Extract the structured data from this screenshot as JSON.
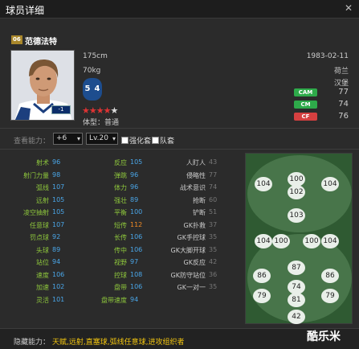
{
  "window": {
    "title": "球员详细",
    "close_glyph": "✕"
  },
  "player": {
    "position_badge": "06",
    "name": "范德法特",
    "height": "175cm",
    "weight": "70kg",
    "left_foot": "5",
    "right_foot": "4",
    "star_rating": 4,
    "star_max": 5,
    "body_type": "体型：普通",
    "birth_date": "1983-02-11",
    "nation": "荷兰",
    "club": "汉堡",
    "foot_badge": "-1"
  },
  "roles": [
    {
      "code": "CAM",
      "value": "77",
      "color": "#2eaa4a"
    },
    {
      "code": "CM",
      "value": "74",
      "color": "#2eaa4a"
    },
    {
      "code": "CF",
      "value": "76",
      "color": "#d64040"
    }
  ],
  "controls": {
    "view_label": "查看能力：",
    "plus_select": "+6",
    "level_select": "Lv.20",
    "checkbox_strong": "强化套",
    "checkbox_team": "队套",
    "arrow": "▾"
  },
  "stats_col1": [
    {
      "label": "射术",
      "value": "96"
    },
    {
      "label": "射门力量",
      "value": "98"
    },
    {
      "label": "弧线",
      "value": "107"
    },
    {
      "label": "远射",
      "value": "105"
    },
    {
      "label": "凌空抽射",
      "value": "105"
    },
    {
      "label": "任意球",
      "value": "107"
    },
    {
      "label": "罚点球",
      "value": "92"
    },
    {
      "label": "头球",
      "value": "89"
    },
    {
      "label": "站位",
      "value": "94"
    },
    {
      "label": "速度",
      "value": "106"
    },
    {
      "label": "加速",
      "value": "102"
    },
    {
      "label": "灵活",
      "value": "101"
    }
  ],
  "stats_col2": [
    {
      "label": "反应",
      "value": "105"
    },
    {
      "label": "弹跳",
      "value": "96"
    },
    {
      "label": "体力",
      "value": "96"
    },
    {
      "label": "强壮",
      "value": "89"
    },
    {
      "label": "平衡",
      "value": "100"
    },
    {
      "label": "短传",
      "value": "112",
      "highlight": "#f08a24"
    },
    {
      "label": "长传",
      "value": "106"
    },
    {
      "label": "传中",
      "value": "106"
    },
    {
      "label": "视野",
      "value": "97"
    },
    {
      "label": "控球",
      "value": "108"
    },
    {
      "label": "盘带",
      "value": "106"
    },
    {
      "label": "盘带速度",
      "value": "94"
    }
  ],
  "stats_col3": [
    {
      "label": "人盯人",
      "value": "43"
    },
    {
      "label": "侵略性",
      "value": "77"
    },
    {
      "label": "战术意识",
      "value": "74"
    },
    {
      "label": "抢断",
      "value": "60"
    },
    {
      "label": "铲断",
      "value": "51"
    },
    {
      "label": "GK扑救",
      "value": "37"
    },
    {
      "label": "GK手控球",
      "value": "35"
    },
    {
      "label": "GK大脚开球",
      "value": "35"
    },
    {
      "label": "GK反应",
      "value": "42"
    },
    {
      "label": "GK防守站位",
      "value": "36"
    },
    {
      "label": "GK一对一",
      "value": "35"
    }
  ],
  "pitch_ratings": [
    {
      "value": "100"
    },
    {
      "value": "104"
    },
    {
      "value": "102"
    },
    {
      "value": "104"
    },
    {
      "value": "103"
    },
    {
      "value": "104"
    },
    {
      "value": "100"
    },
    {
      "value": "100"
    },
    {
      "value": "104"
    },
    {
      "value": "87"
    },
    {
      "value": "86"
    },
    {
      "value": "86"
    },
    {
      "value": "74"
    },
    {
      "value": "79"
    },
    {
      "value": "81"
    },
    {
      "value": "79"
    },
    {
      "value": "42"
    }
  ],
  "hidden": {
    "label": "隐藏能力：",
    "value": "天赋,远射,直塞球,弧线任意球,进攻组织者"
  },
  "watermark": "酷乐米"
}
